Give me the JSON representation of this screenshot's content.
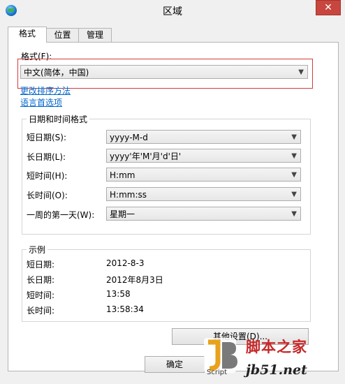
{
  "window": {
    "title": "区域",
    "close_glyph": "✕",
    "icon": "globe-icon"
  },
  "tabs": [
    {
      "label": "格式",
      "active": true
    },
    {
      "label": "位置",
      "active": false
    },
    {
      "label": "管理",
      "active": false
    }
  ],
  "format": {
    "label": "格式(F):",
    "selected": "中文(简体，中国)"
  },
  "links": {
    "change_sort": "更改排序方法",
    "language_prefs": "语言首选项"
  },
  "datetime": {
    "legend": "日期和时间格式",
    "rows": [
      {
        "label": "短日期(S):",
        "value": "yyyy-M-d"
      },
      {
        "label": "长日期(L):",
        "value": "yyyy'年'M'月'd'日'"
      },
      {
        "label": "短时间(H):",
        "value": "H:mm"
      },
      {
        "label": "长时间(O):",
        "value": "H:mm:ss"
      },
      {
        "label": "一周的第一天(W):",
        "value": "星期一"
      }
    ]
  },
  "examples": {
    "legend": "示例",
    "rows": [
      {
        "label": "短日期:",
        "value": "2012-8-3"
      },
      {
        "label": "长日期:",
        "value": "2012年8月3日"
      },
      {
        "label": "短时间:",
        "value": "13:58"
      },
      {
        "label": "长时间:",
        "value": "13:58:34"
      }
    ]
  },
  "buttons": {
    "additional": "其他设置(D)...",
    "ok": "确定"
  },
  "watermark": {
    "brand": "脚本之家",
    "url": "jb51.net",
    "script": "Script"
  }
}
